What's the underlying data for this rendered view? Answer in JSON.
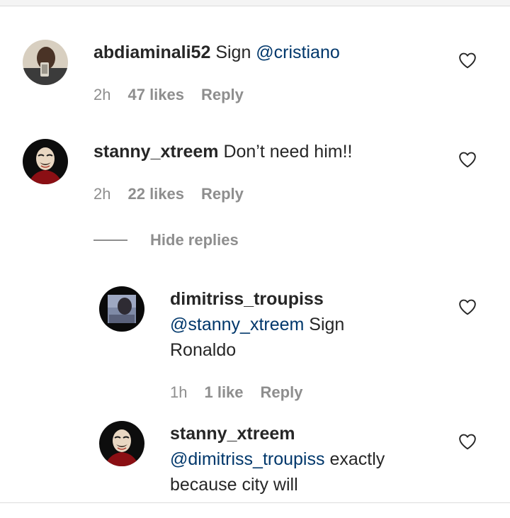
{
  "comments": [
    {
      "username": "abdiaminali52",
      "text_prefix": "Sign ",
      "mention": "@cristiano",
      "text_suffix": "",
      "time": "2h",
      "likes": "47 likes",
      "reply": "Reply",
      "avatar_icon": "person-photo-avatar",
      "heart_icon": "heart-outline-icon"
    },
    {
      "username": "stanny_xtreem",
      "text_prefix": "Don’t need him!!",
      "mention": "",
      "text_suffix": "",
      "time": "2h",
      "likes": "22 likes",
      "reply": "Reply",
      "avatar_icon": "mask-avatar",
      "heart_icon": "heart-outline-icon"
    }
  ],
  "hide_replies": "Hide replies",
  "replies": [
    {
      "username": "dimitriss_troupiss",
      "mention": "@stanny_xtreem",
      "text_after_mention": "Sign",
      "line3": "Ronaldo",
      "time": "1h",
      "likes": "1 like",
      "reply": "Reply",
      "avatar_icon": "photo-avatar",
      "heart_icon": "heart-outline-icon"
    },
    {
      "username": "stanny_xtreem",
      "mention": "@dimitriss_troupiss",
      "text_after_mention": "exactly",
      "line3": "because city will",
      "avatar_icon": "mask-avatar",
      "heart_icon": "heart-outline-icon"
    }
  ],
  "colors": {
    "text": "#262626",
    "meta": "#8e8e8e",
    "mention": "#00376b"
  }
}
